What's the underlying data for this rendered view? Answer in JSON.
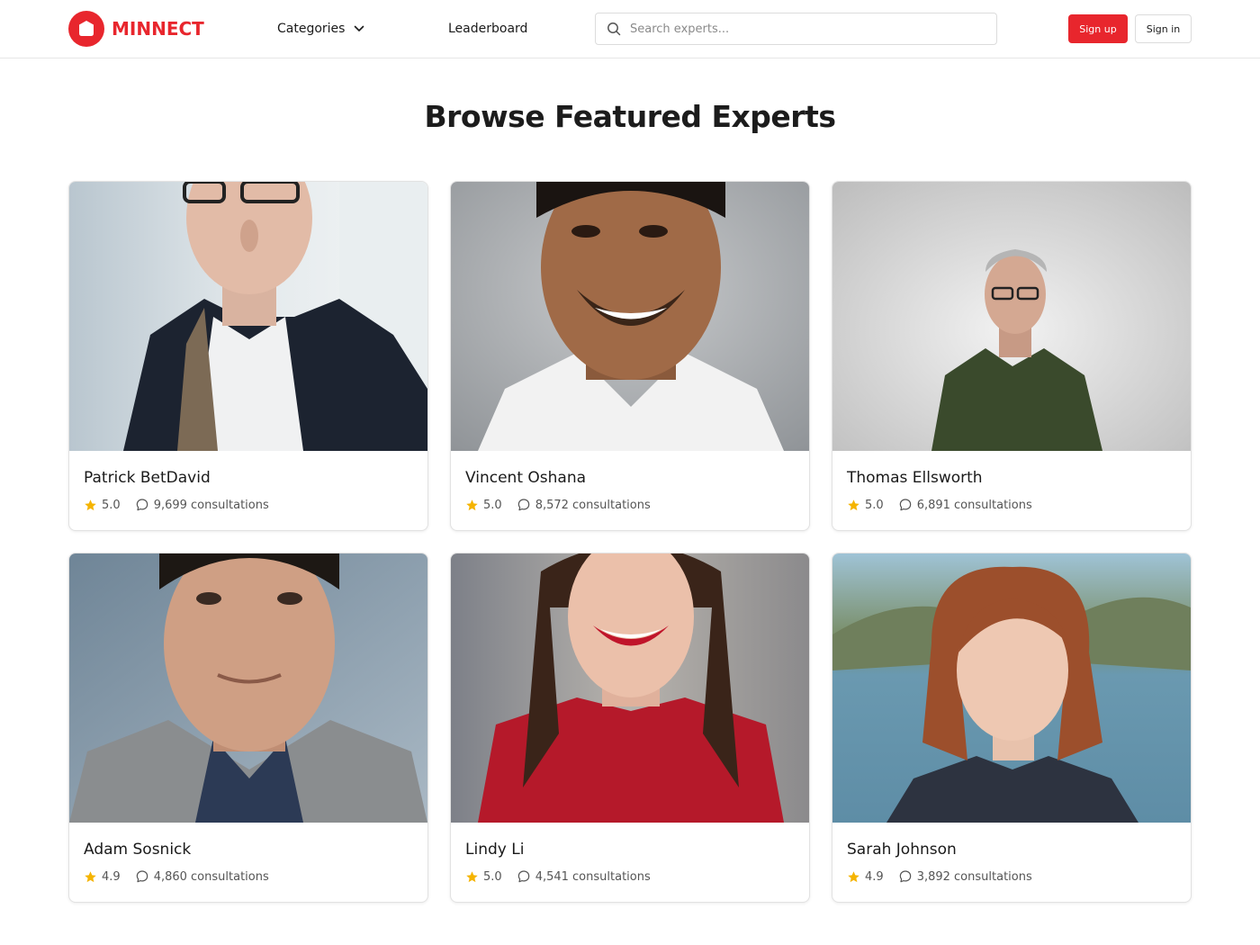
{
  "header": {
    "brand": "MINNECT",
    "nav": {
      "categories": "Categories",
      "leaderboard": "Leaderboard"
    },
    "search": {
      "placeholder": "Search experts..."
    },
    "signup_label": "Sign up",
    "signin_label": "Sign in"
  },
  "main": {
    "title": "Browse Featured Experts",
    "experts": [
      {
        "name": "Patrick BetDavid",
        "rating": "5.0",
        "consultations": "9,699 consultations"
      },
      {
        "name": "Vincent Oshana",
        "rating": "5.0",
        "consultations": "8,572 consultations"
      },
      {
        "name": "Thomas Ellsworth",
        "rating": "5.0",
        "consultations": "6,891 consultations"
      },
      {
        "name": "Adam Sosnick",
        "rating": "4.9",
        "consultations": "4,860 consultations"
      },
      {
        "name": "Lindy Li",
        "rating": "5.0",
        "consultations": "4,541 consultations"
      },
      {
        "name": "Sarah Johnson",
        "rating": "4.9",
        "consultations": "3,892 consultations"
      }
    ]
  },
  "colors": {
    "brand": "#e8262d",
    "star": "#f5b400",
    "text": "#1a1a1a",
    "muted": "#555555"
  },
  "icons": {
    "logo": "hexagon-logo-icon",
    "categories_chevron": "chevron-down-icon",
    "search": "search-icon",
    "rating": "star-icon",
    "consultations": "chat-bubble-icon"
  }
}
